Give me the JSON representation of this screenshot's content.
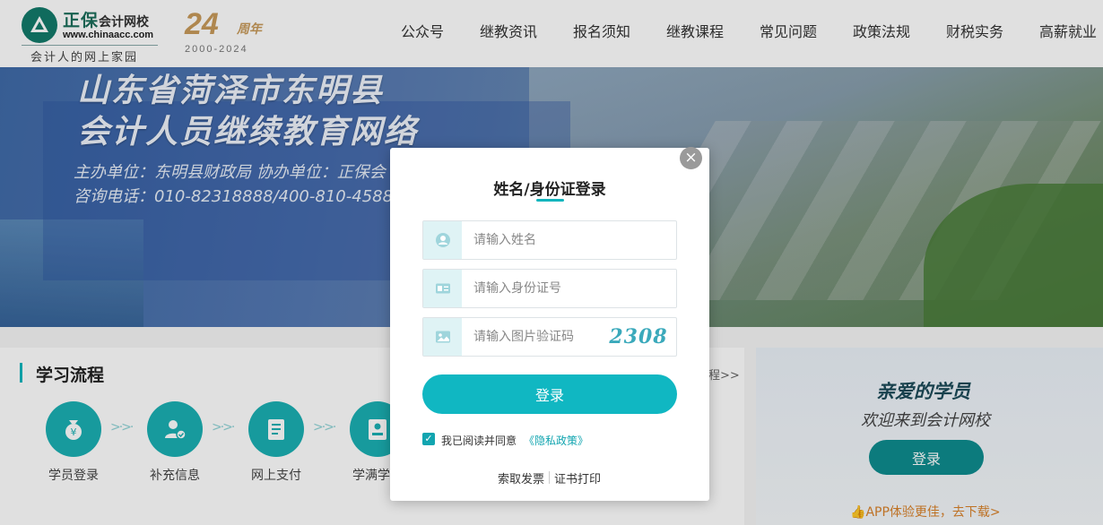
{
  "header": {
    "logo_brand": "正保",
    "logo_brand_suffix": "会计网校",
    "logo_url": "www.chinaacc.com",
    "logo_slogan": "会计人的网上家园",
    "anniversary_number": "24",
    "anniversary_text": "周年",
    "anniversary_years": "2000-2024",
    "nav": [
      "公众号",
      "继教资讯",
      "报名须知",
      "继教课程",
      "常见问题",
      "政策法规",
      "财税实务",
      "高薪就业"
    ]
  },
  "banner": {
    "title_line1": "山东省菏泽市东明县",
    "title_line2": "会计人员继续教育网络",
    "sponsor": "主办单位：东明县财政局  协办单位：正保会",
    "phone": "咨询电话：010-82318888/400-810-4588"
  },
  "process": {
    "title": "学习流程",
    "more": "程>>",
    "steps": [
      "学员登录",
      "补充信息",
      "网上支付",
      "学满学"
    ]
  },
  "side": {
    "title": "亲爱的学员",
    "subtitle": "欢迎来到会计网校",
    "login_label": "登录",
    "app_text": "APP体验更佳，去下载>"
  },
  "modal": {
    "title": "姓名/身份证登录",
    "name_placeholder": "请输入姓名",
    "id_placeholder": "请输入身份证号",
    "captcha_placeholder": "请输入图片验证码",
    "captcha_code": "2308",
    "login_label": "登录",
    "agree_text": "我已阅读并同意",
    "privacy_link": "《隐私政策》",
    "invoice_link": "索取发票",
    "certificate_link": "证书打印",
    "close_glyph": "×",
    "check_glyph": "✓"
  },
  "colors": {
    "accent": "#12b5bd",
    "brand_green": "#1b6e5a",
    "anniversary_gold": "#c89a5a",
    "app_orange": "#d9822b"
  }
}
